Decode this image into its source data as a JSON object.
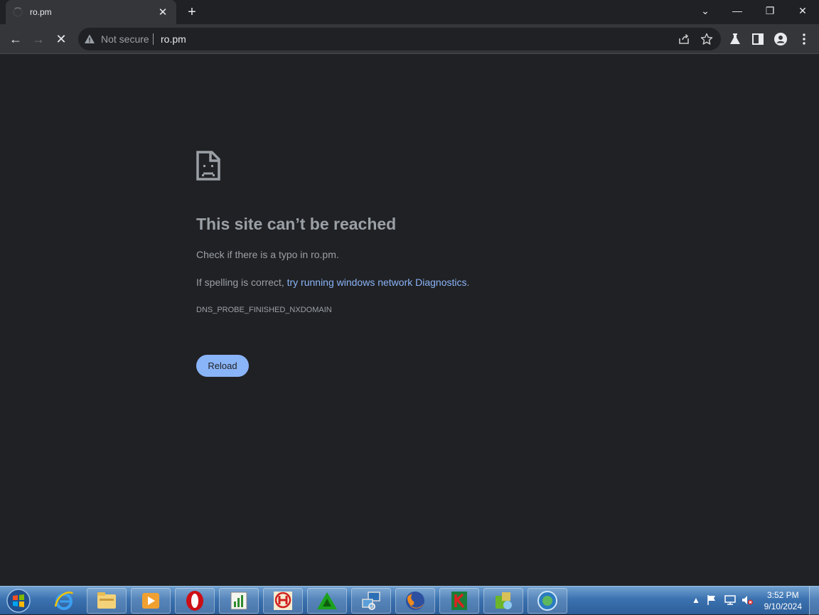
{
  "tab": {
    "title": "ro.pm",
    "close": "✕"
  },
  "newtab": "+",
  "window_controls": {
    "tabsearch": "⌄",
    "minimize": "—",
    "restore": "❐",
    "close": "✕"
  },
  "nav": {
    "back": "←",
    "forward": "→",
    "stop": "✕"
  },
  "omnibox": {
    "security": "Not secure",
    "url": "ro.pm"
  },
  "error": {
    "title": "This site can’t be reached",
    "line1": "Check if there is a typo in ro.pm.",
    "line2_prefix": "If spelling is correct, ",
    "line2_link": "try running windows network Diagnostics",
    "line2_suffix": ".",
    "code": "DNS_PROBE_FINISHED_NXDOMAIN",
    "reload": "Reload"
  },
  "taskbar": {
    "apps": [
      "ie-icon",
      "explorer-icon",
      "media-player-icon",
      "opera-icon",
      "notepad-chart-icon",
      "h-app-icon",
      "green-triangle-icon",
      "network-app-icon",
      "firefox-icon",
      "kaspersky-icon",
      "utility-icon",
      "globe-icon"
    ],
    "clock_time": "3:52 PM",
    "clock_date": "9/10/2024"
  },
  "colors": {
    "page_bg": "#202124",
    "link": "#8ab4f8",
    "button": "#8ab4f8",
    "text": "#9aa0a6"
  }
}
